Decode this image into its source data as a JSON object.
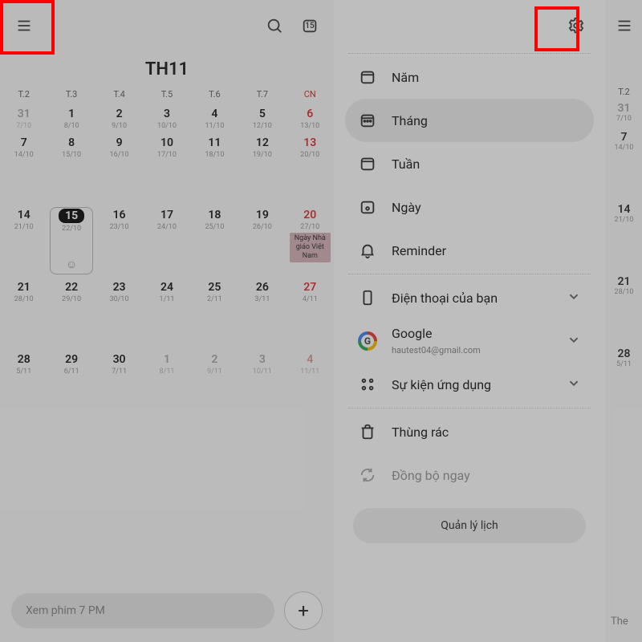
{
  "header": {
    "today_badge": "15",
    "month_title": "TH11"
  },
  "weekdays": [
    "T.2",
    "T.3",
    "T.4",
    "T.5",
    "T.6",
    "T.7",
    "CN"
  ],
  "rows": [
    [
      {
        "solar": "31",
        "lunar": "7/10",
        "dim": true
      },
      {
        "solar": "1",
        "lunar": "8/10"
      },
      {
        "solar": "2",
        "lunar": "9/10"
      },
      {
        "solar": "3",
        "lunar": "10/10"
      },
      {
        "solar": "4",
        "lunar": "11/10"
      },
      {
        "solar": "5",
        "lunar": "12/10"
      },
      {
        "solar": "6",
        "lunar": "13/10",
        "sun": true
      }
    ],
    [
      {
        "solar": "7",
        "lunar": "14/10"
      },
      {
        "solar": "8",
        "lunar": "15/10"
      },
      {
        "solar": "9",
        "lunar": "16/10"
      },
      {
        "solar": "10",
        "lunar": "17/10"
      },
      {
        "solar": "11",
        "lunar": "18/10"
      },
      {
        "solar": "12",
        "lunar": "19/10"
      },
      {
        "solar": "13",
        "lunar": "20/10",
        "sun": true
      }
    ],
    [
      {
        "solar": "14",
        "lunar": "21/10"
      },
      {
        "solar": "15",
        "lunar": "22/10",
        "today": true
      },
      {
        "solar": "16",
        "lunar": "23/10"
      },
      {
        "solar": "17",
        "lunar": "24/10"
      },
      {
        "solar": "18",
        "lunar": "25/10"
      },
      {
        "solar": "19",
        "lunar": "26/10"
      },
      {
        "solar": "20",
        "lunar": "27/10",
        "sun": true,
        "event": "Ngày Nhà giáo Việt Nam"
      }
    ],
    [
      {
        "solar": "21",
        "lunar": "28/10"
      },
      {
        "solar": "22",
        "lunar": "29/10"
      },
      {
        "solar": "23",
        "lunar": "30/10"
      },
      {
        "solar": "24",
        "lunar": "1/11"
      },
      {
        "solar": "25",
        "lunar": "2/11"
      },
      {
        "solar": "26",
        "lunar": "3/11"
      },
      {
        "solar": "27",
        "lunar": "4/11",
        "sun": true
      }
    ],
    [
      {
        "solar": "28",
        "lunar": "5/11"
      },
      {
        "solar": "29",
        "lunar": "6/11"
      },
      {
        "solar": "30",
        "lunar": "7/11"
      },
      {
        "solar": "1",
        "lunar": "8/11",
        "dim": true
      },
      {
        "solar": "2",
        "lunar": "9/11",
        "dim": true
      },
      {
        "solar": "3",
        "lunar": "10/11",
        "dim": true
      },
      {
        "solar": "4",
        "lunar": "11/11",
        "dim": true,
        "sun": true
      }
    ]
  ],
  "quick_event_hint": "Xem phim 7 PM",
  "drawer": {
    "views": {
      "year": "Năm",
      "month": "Tháng",
      "week": "Tuần",
      "day": "Ngày",
      "reminder": "Reminder"
    },
    "accounts": {
      "phone": "Điện thoại của bạn",
      "google_label": "Google",
      "google_email": "hautest04@gmail.com",
      "app_events": "Sự kiện ứng dụng"
    },
    "footer": {
      "trash": "Thùng rác",
      "sync": "Đồng bộ ngay",
      "manage": "Quản lý lịch"
    }
  },
  "far_right": {
    "wk": "T.2",
    "cells": [
      {
        "solar": "31",
        "lunar": "7/10",
        "dim": true
      },
      {
        "solar": "7",
        "lunar": "14/10"
      },
      {
        "solar": "14",
        "lunar": "21/10"
      },
      {
        "solar": "21",
        "lunar": "28/10"
      },
      {
        "solar": "28",
        "lunar": "5/11"
      }
    ],
    "bottom_hint": "The"
  }
}
